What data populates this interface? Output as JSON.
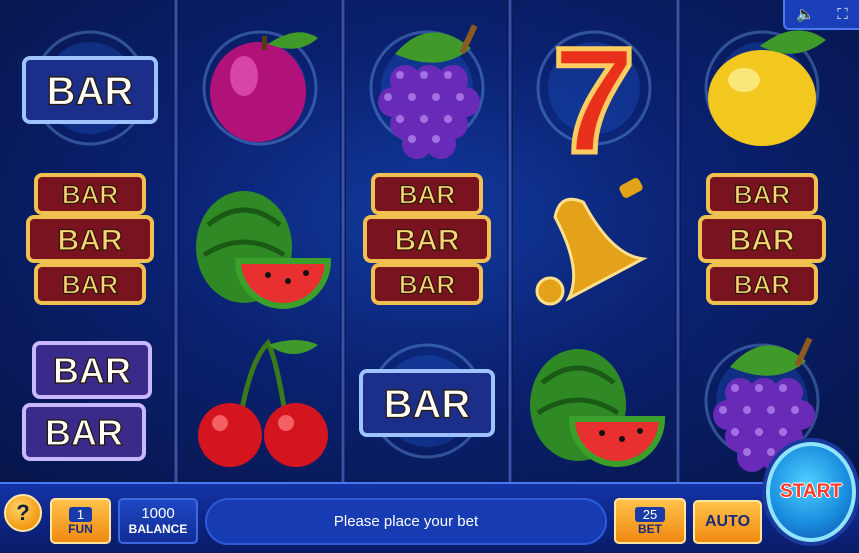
{
  "reels": [
    [
      "bar-single",
      "triple-bar",
      "double-bar"
    ],
    [
      "plum",
      "watermelon",
      "cherries"
    ],
    [
      "grapes",
      "triple-bar",
      "bar-single"
    ],
    [
      "seven",
      "bell",
      "watermelon"
    ],
    [
      "lemon",
      "triple-bar",
      "grapes"
    ]
  ],
  "symbols": {
    "bar_text": "BAR",
    "seven_text": "7"
  },
  "controls": {
    "sound_icon": "speaker-icon",
    "fullscreen_icon": "fullscreen-icon"
  },
  "panel": {
    "help_label": "?",
    "fun_value": "1",
    "fun_label": "FUN",
    "balance_value": "1000",
    "balance_label": "BALANCE",
    "message": "Please place your bet",
    "bet_value": "25",
    "bet_label": "BET",
    "auto_label": "AUTO",
    "start_label": "START"
  },
  "colors": {
    "accent_orange": "#f08a10",
    "panel_blue": "#0c2380",
    "start_text": "#ff3a2a"
  }
}
